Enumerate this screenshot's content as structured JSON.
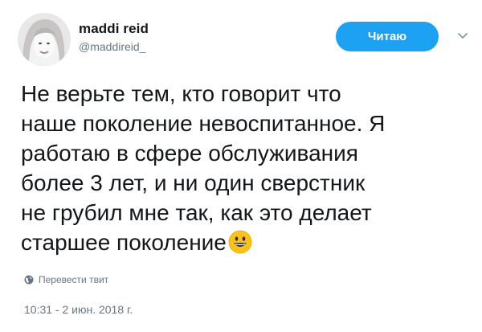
{
  "user": {
    "name": "maddi reid",
    "handle": "@maddireid_"
  },
  "follow_button": {
    "label": "Читаю",
    "color": "#1da1f2"
  },
  "menu": {
    "icon": "chevron-down-icon"
  },
  "tweet": {
    "lines": [
      "Не верьте тем, кто говорит что",
      "наше поколение невоспитанное. Я",
      "работаю в сфере обслуживания",
      "более 3 лет, и ни один сверстник",
      "не грубил мне так, как это делает",
      "старшее поколение"
    ],
    "emoji": "smiling-face-icon"
  },
  "translate": {
    "label": "Перевести твит",
    "icon": "globe-icon"
  },
  "timestamp": "10:31 - 2 июн. 2018 г.",
  "colors": {
    "text": "#14171a",
    "secondary": "#657786",
    "accent": "#1da1f2"
  }
}
